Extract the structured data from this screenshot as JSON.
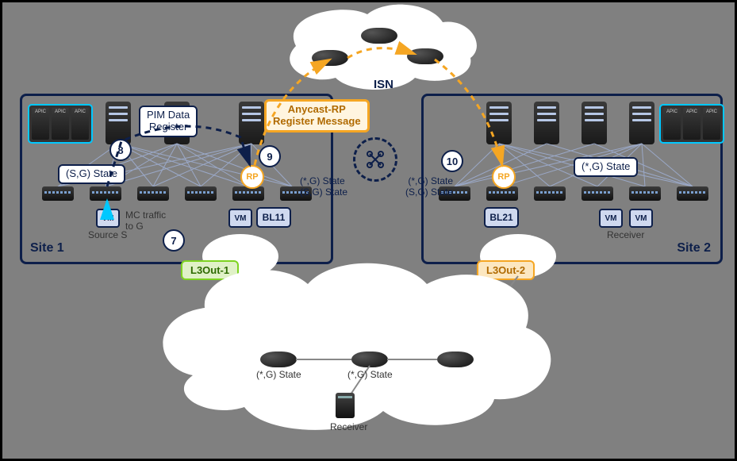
{
  "isn_label": "ISN",
  "anycast_label": "Anycast-RP\nRegister Message",
  "pim_label": "PIM Data\nRegister",
  "site1": {
    "name": "Site 1",
    "sg_state": "(S,G) State",
    "source_label": "Source S",
    "mc_traffic": "MC traffic\nto G",
    "star_g_state": "(*,G) State\n(S,G) State",
    "bl": "BL11",
    "l3out": "L3Out-1"
  },
  "site2": {
    "name": "Site 2",
    "star_g": "(*,G) State",
    "star_g_state": "(*,G) State\n(S,G) State",
    "bl": "BL21",
    "receiver": "Receiver",
    "l3out": "L3Out-2"
  },
  "steps": {
    "s7": "7",
    "s8": "8",
    "s9": "9",
    "s10": "10"
  },
  "rp": "RP",
  "vm": "VM",
  "external": {
    "left_state": "(*,G) State",
    "mid_state": "(*,G) State",
    "receiver": "Receiver"
  }
}
